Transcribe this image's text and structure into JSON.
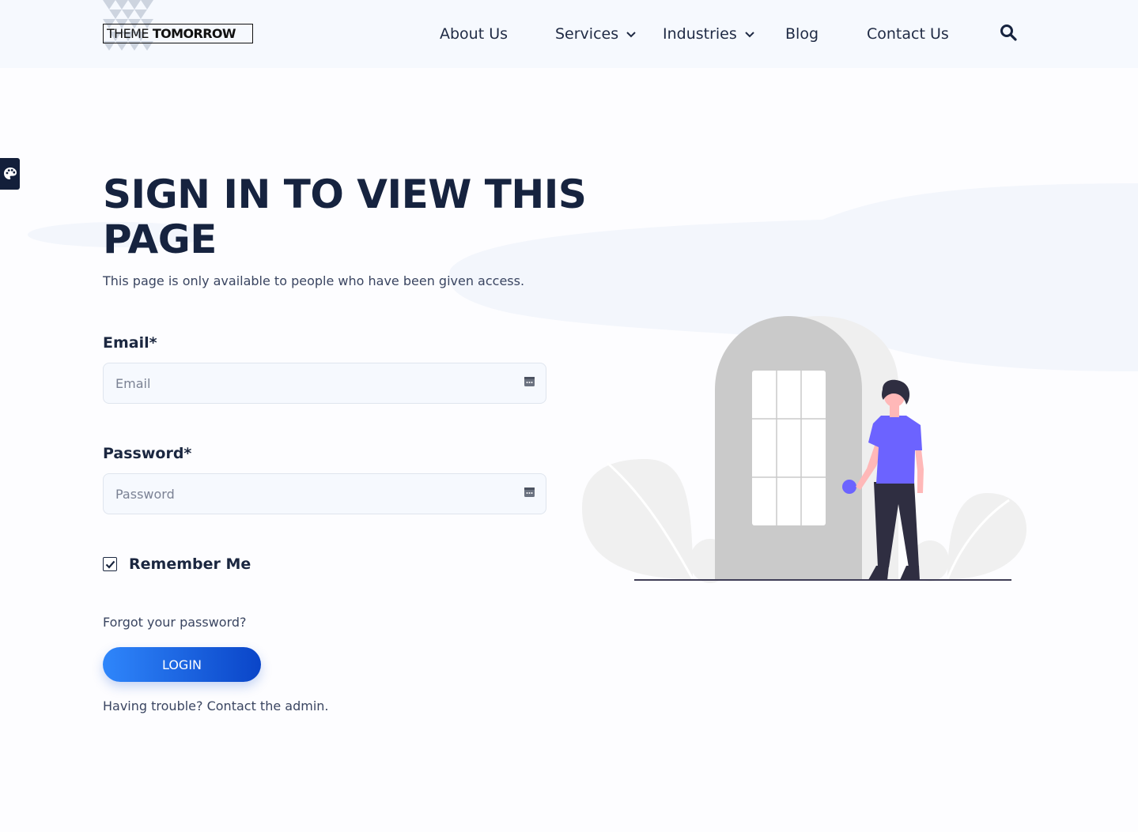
{
  "header": {
    "logo": {
      "thin": "THEME",
      "bold": "TOMORROW"
    },
    "nav": [
      {
        "label": "About Us",
        "has_dropdown": false
      },
      {
        "label": "Services",
        "has_dropdown": true
      },
      {
        "label": "Industries",
        "has_dropdown": true
      },
      {
        "label": "Blog",
        "has_dropdown": false
      },
      {
        "label": "Contact Us",
        "has_dropdown": false
      }
    ],
    "search_icon": "search-icon"
  },
  "side_tab_icon": "palette-icon",
  "main": {
    "title": "SIGN IN TO VIEW THIS PAGE",
    "subtitle": "This page is only available to people who have been given access.",
    "email": {
      "label": "Email*",
      "placeholder": "Email",
      "value": ""
    },
    "password": {
      "label": "Password*",
      "placeholder": "Password",
      "value": ""
    },
    "remember": {
      "label": "Remember Me",
      "checked": true
    },
    "forgot_link": "Forgot your password?",
    "login_label": "LOGIN",
    "trouble_text": "Having trouble? Contact the admin."
  },
  "colors": {
    "header_bg": "#f6f9fe",
    "title": "#16233f",
    "button_start": "#2f86fb",
    "button_end": "#0a45c8",
    "person_shirt": "#6c63ff",
    "door": "#cacaca"
  }
}
